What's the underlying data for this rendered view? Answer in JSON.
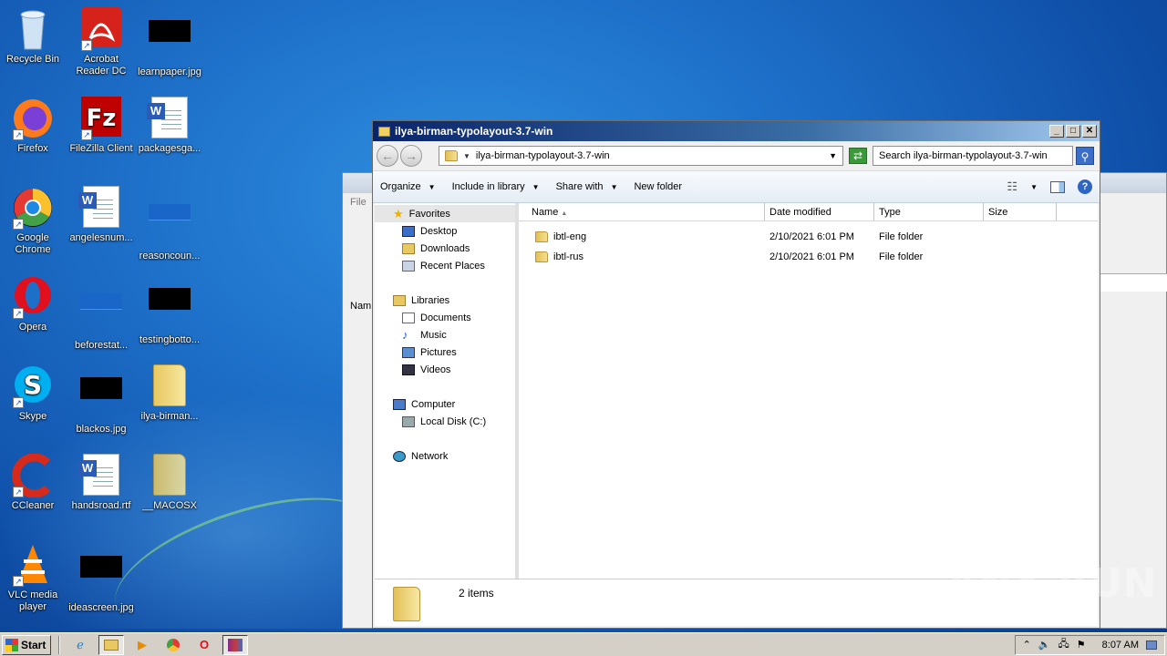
{
  "desktop": {
    "icons": [
      {
        "label": "Recycle Bin",
        "icon": "recycle-bin-icon"
      },
      {
        "label": "Acrobat Reader DC",
        "icon": "acrobat-icon"
      },
      {
        "label": "learnpaper.jpg",
        "icon": "image-file-icon"
      },
      {
        "label": "Firefox",
        "icon": "firefox-icon"
      },
      {
        "label": "FileZilla Client",
        "icon": "filezilla-icon"
      },
      {
        "label": "packagesga...",
        "icon": "word-doc-icon"
      },
      {
        "label": "Google Chrome",
        "icon": "chrome-icon"
      },
      {
        "label": "angelesnum...",
        "icon": "word-doc-icon"
      },
      {
        "label": "reasoncoun...",
        "icon": "file-icon"
      },
      {
        "label": "Opera",
        "icon": "opera-icon"
      },
      {
        "label": "beforestat...",
        "icon": "file-icon"
      },
      {
        "label": "testingbotto...",
        "icon": "image-file-icon"
      },
      {
        "label": "Skype",
        "icon": "skype-icon"
      },
      {
        "label": "blackos.jpg",
        "icon": "image-file-icon"
      },
      {
        "label": "ilya-birman...",
        "icon": "zip-folder-icon"
      },
      {
        "label": "CCleaner",
        "icon": "ccleaner-icon"
      },
      {
        "label": "handsroad.rtf",
        "icon": "word-doc-icon"
      },
      {
        "label": "__MACOSX",
        "icon": "folder-icon"
      },
      {
        "label": "VLC media player",
        "icon": "vlc-icon"
      },
      {
        "label": "ideascreen.jpg",
        "icon": "image-file-icon"
      }
    ]
  },
  "back_window": {
    "menu_label": "File",
    "col_label": "Nam"
  },
  "explorer": {
    "title": "ilya-birman-typolayout-3.7-win",
    "address": "ilya-birman-typolayout-3.7-win",
    "search_placeholder": "Search ilya-birman-typolayout-3.7-win",
    "toolbar": {
      "organize": "Organize",
      "include": "Include in library",
      "share": "Share with",
      "new_folder": "New folder"
    },
    "nav": {
      "favorites": "Favorites",
      "desktop": "Desktop",
      "downloads": "Downloads",
      "recent": "Recent Places",
      "libraries": "Libraries",
      "documents": "Documents",
      "music": "Music",
      "pictures": "Pictures",
      "videos": "Videos",
      "computer": "Computer",
      "local_disk": "Local Disk (C:)",
      "network": "Network"
    },
    "columns": {
      "name": "Name",
      "date": "Date modified",
      "type": "Type",
      "size": "Size"
    },
    "files": [
      {
        "name": "ibtl-eng",
        "date": "2/10/2021 6:01 PM",
        "type": "File folder"
      },
      {
        "name": "ibtl-rus",
        "date": "2/10/2021 6:01 PM",
        "type": "File folder"
      }
    ],
    "status": "2 items"
  },
  "taskbar": {
    "start": "Start",
    "clock": "8:07 AM"
  },
  "watermark": "ANY RUN"
}
